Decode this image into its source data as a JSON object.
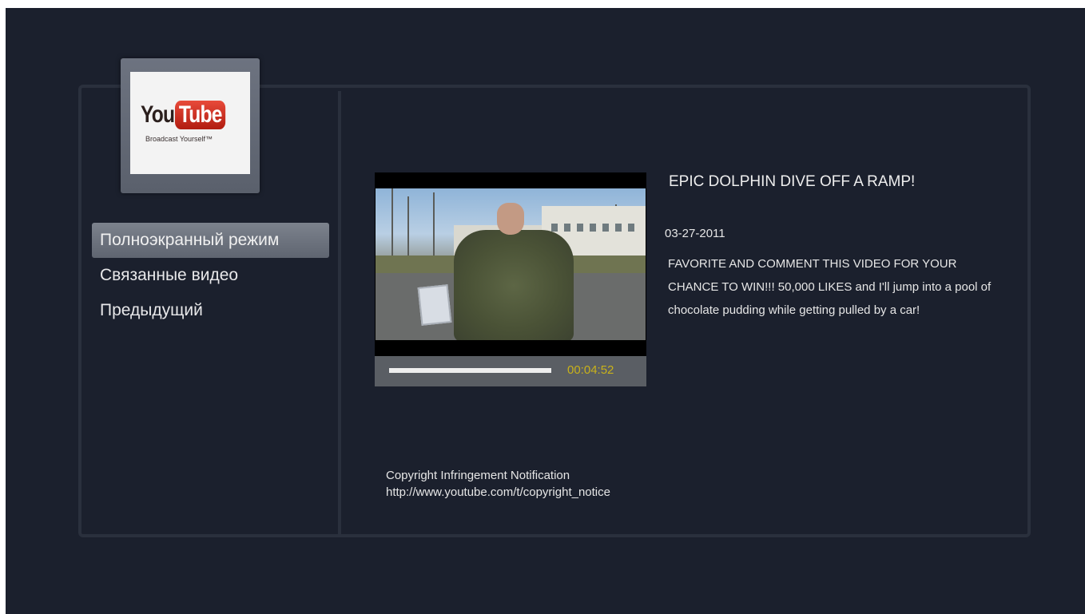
{
  "logo": {
    "word1": "You",
    "word2": "Tube",
    "tagline": "Broadcast Yourself™"
  },
  "menu": {
    "items": [
      {
        "label": "Полноэкранный режим",
        "selected": true
      },
      {
        "label": "Связанные видео",
        "selected": false
      },
      {
        "label": "Предыдущий",
        "selected": false
      }
    ]
  },
  "video": {
    "title": "EPIC DOLPHIN DIVE OFF A RAMP!",
    "date": "03-27-2011",
    "description": "FAVORITE AND COMMENT THIS VIDEO FOR YOUR CHANCE TO WIN!!! 50,000 LIKES and I'll jump into a pool of chocolate pudding while getting pulled by a car!",
    "duration": "00:04:52",
    "progress_fraction": 1.0
  },
  "footer": {
    "line1": "Copyright Infringement Notification",
    "line2": "http://www.youtube.com/t/copyright_notice"
  },
  "colors": {
    "background": "#1b202d",
    "panel_border": "#2a303d",
    "timecode": "#c9b21a",
    "youtube_red": "#cc2a1c"
  }
}
